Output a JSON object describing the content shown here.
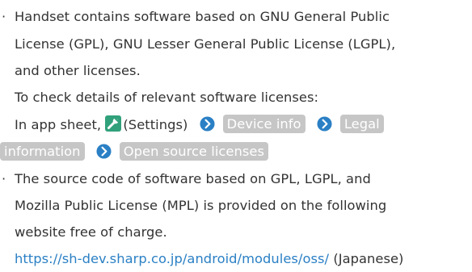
{
  "bullets": [
    {
      "marker": "·",
      "lines": [
        "Handset contains software based on GNU General Public",
        "License (GPL), GNU Lesser General Public License (LGPL),",
        "and other licenses.",
        "To check details of relevant software licenses:"
      ],
      "path": {
        "prefix": "In app sheet,",
        "settings_label": "(Settings)",
        "settings_icon": "wrench-icon",
        "steps": [
          "Device info",
          "Legal",
          "information",
          "Open source licenses"
        ]
      }
    },
    {
      "marker": "·",
      "lines": [
        "The source code of software based on GPL, LGPL, and",
        "Mozilla Public License (MPL) is provided on the following",
        "website free of charge."
      ],
      "link": {
        "url_text": "https://sh-dev.sharp.co.jp/android/modules/oss/",
        "suffix": "(Japanese)"
      }
    }
  ],
  "colors": {
    "text": "#333333",
    "chip_bg": "#c6c6c6",
    "arrow": "#2b80c5",
    "link": "#2b80c5",
    "settings_icon_bg": "#31a17b"
  }
}
